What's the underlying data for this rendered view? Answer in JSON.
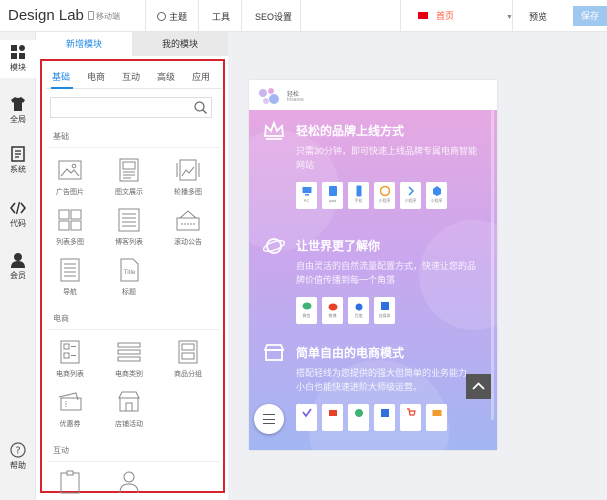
{
  "header": {
    "logo": "Design Lab",
    "mobile": "移动端",
    "menus": [
      "主题",
      "工具",
      "SEO设置"
    ],
    "page": "首页",
    "preview": "预览",
    "save": "保存"
  },
  "leftbar": {
    "items": [
      "模块",
      "全局",
      "系统",
      "代码",
      "会员"
    ],
    "help": "帮助"
  },
  "panel": {
    "tabs": [
      "新增模块",
      "我的模块"
    ],
    "categories": [
      "基础",
      "电商",
      "互动",
      "高级",
      "应用"
    ],
    "sections": {
      "basic": "基础",
      "ecommerce": "电商",
      "interact": "互动"
    },
    "basic_modules": [
      "广告图片",
      "图文展示",
      "轮播多图",
      "列表多图",
      "博客列表",
      "滚动公告",
      "导航",
      "标题"
    ],
    "ecommerce_modules": [
      "电商列表",
      "电商类别",
      "商品分组",
      "优惠券",
      "店铺活动"
    ]
  },
  "phone": {
    "brand": "轻松",
    "brand_sub": "Irisarea",
    "feature1": {
      "title": "轻松的品牌上线方式",
      "desc": "只需30分钟，即可快速上线品牌专属电商智能网站",
      "chips": [
        "PC",
        "ipad",
        "手机",
        "小程序",
        "小程序",
        "小程序"
      ]
    },
    "feature2": {
      "title": "让世界更了解你",
      "desc": "自由灵活的自然流量配置方式，快速让您的品牌价值传播到每一个角落",
      "chips": [
        "微信",
        "微博",
        "百度",
        "自媒体"
      ]
    },
    "feature3": {
      "title": "简单自由的电商模式",
      "desc": "搭配轻线为您提供的强大但简单的业务能力，小白也能快速进阶大师级运营。",
      "chips": [
        "",
        "",
        "",
        "",
        "",
        ""
      ]
    }
  },
  "colors": {
    "accent": "#1e88e5",
    "highlight_border": "#d9232d",
    "save_button": "#9ec8f0",
    "page_selector": "#ff5a3c"
  }
}
